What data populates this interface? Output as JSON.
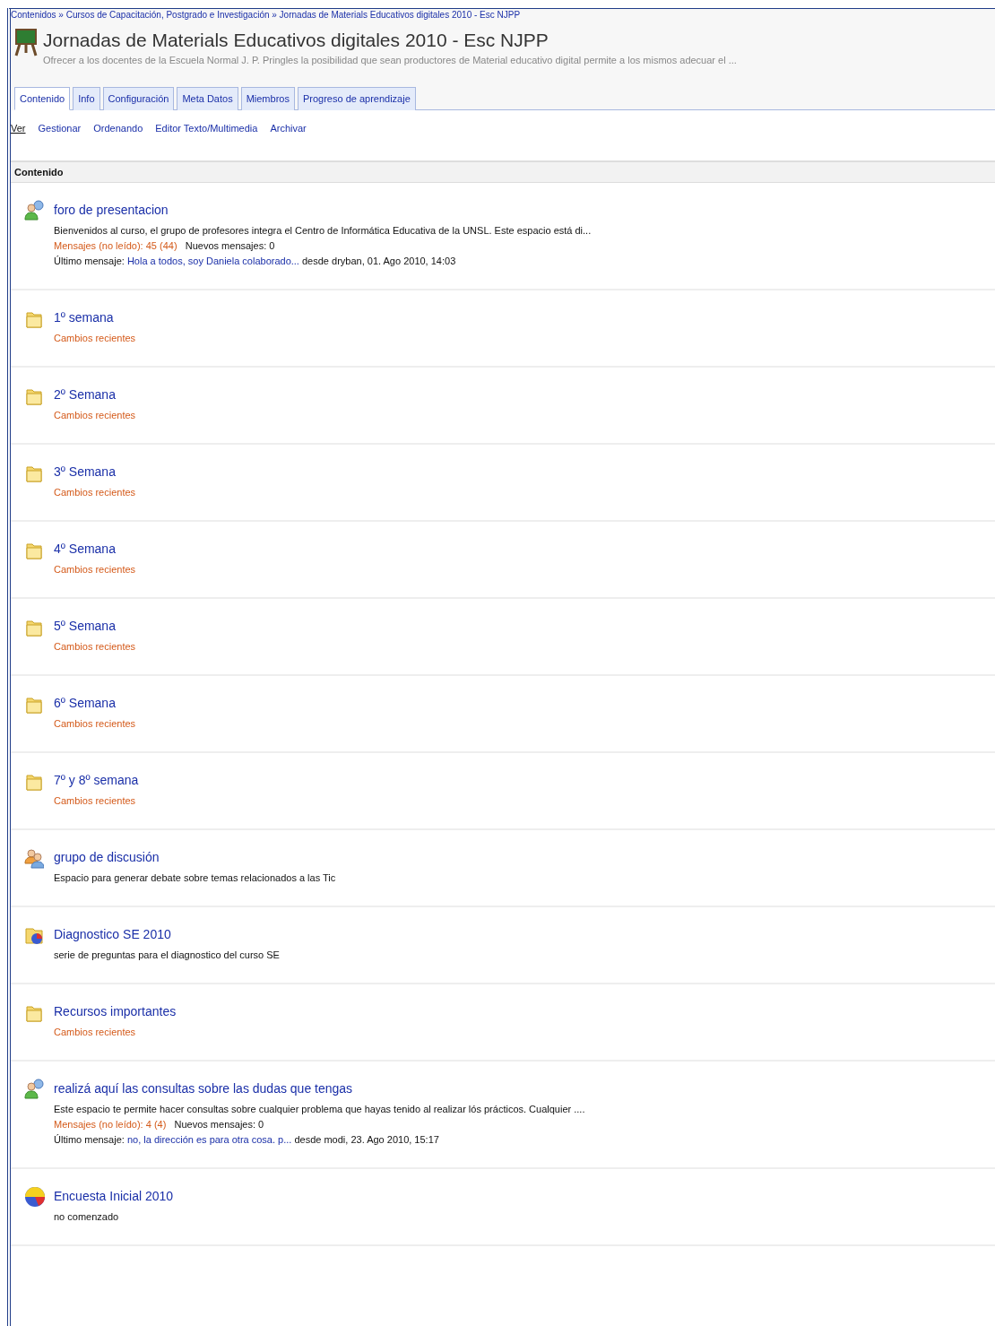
{
  "breadcrumb": "Contenidos » Cursos de Capacitación, Postgrado e Investigación » Jornadas de Materials Educativos digitales 2010 - Esc NJPP",
  "header": {
    "title": "Jornadas de Materials Educativos digitales 2010 - Esc NJPP",
    "description": "Ofrecer a los docentes de la Escuela Normal J. P. Pringles la posibilidad que sean productores de Material educativo digital permite a los mismos adecuar el ..."
  },
  "tabs": [
    {
      "label": "Contenido",
      "selected": true
    },
    {
      "label": "Info",
      "selected": false
    },
    {
      "label": "Configuración",
      "selected": false
    },
    {
      "label": "Meta Datos",
      "selected": false
    },
    {
      "label": "Miembros",
      "selected": false
    },
    {
      "label": "Progreso de aprendizaje",
      "selected": false
    }
  ],
  "subnav": [
    {
      "label": "Ver",
      "selected": true
    },
    {
      "label": "Gestionar",
      "selected": false
    },
    {
      "label": "Ordenando",
      "selected": false
    },
    {
      "label": "Editor Texto/Multimedia",
      "selected": false
    },
    {
      "label": "Archivar",
      "selected": false
    }
  ],
  "section_title": "Contenido",
  "items": [
    {
      "kind": "forum",
      "title": "foro de presentacion",
      "description": "Bienvenidos al curso, el grupo de profesores integra el Centro de Informática Educativa de la UNSL. Este espacio está di...",
      "unread": "Mensajes (no leído): 45 (44)",
      "new_messages": "Nuevos mensajes: 0",
      "last_label": "Último mensaje:",
      "last_link": "Hola  a todos, soy Daniela colaborado...",
      "last_meta": "desde dryban, 01. Ago 2010, 14:03"
    },
    {
      "kind": "folder",
      "title": "1º semana",
      "status": "Cambios recientes"
    },
    {
      "kind": "folder",
      "title": "2º Semana",
      "status": "Cambios recientes"
    },
    {
      "kind": "folder",
      "title": "3º Semana",
      "status": "Cambios recientes"
    },
    {
      "kind": "folder",
      "title": "4º Semana",
      "status": "Cambios recientes"
    },
    {
      "kind": "folder",
      "title": "5º Semana",
      "status": "Cambios recientes"
    },
    {
      "kind": "folder",
      "title": "6º Semana",
      "status": "Cambios recientes"
    },
    {
      "kind": "folder",
      "title": "7º y 8º semana",
      "status": "Cambios recientes"
    },
    {
      "kind": "group",
      "title": "grupo de discusión",
      "description": "Espacio para generar debate sobre temas relacionados a las Tic"
    },
    {
      "kind": "test",
      "title": "Diagnostico SE 2010",
      "description": "serie de preguntas para el diagnostico del curso SE"
    },
    {
      "kind": "folder",
      "title": "Recursos importantes",
      "status": "Cambios recientes"
    },
    {
      "kind": "forum",
      "title": "realizá aquí las consultas sobre las dudas que tengas",
      "description": "Este espacio te permite hacer consultas sobre cualquier problema que hayas tenido al realizar lós prácticos. Cualquier ....",
      "unread": "Mensajes (no leído): 4 (4)",
      "new_messages": "Nuevos mensajes: 0",
      "last_label": "Último mensaje:",
      "last_link": "no, la dirección es para otra cosa. p...",
      "last_meta": "desde modi, 23. Ago 2010, 15:17"
    },
    {
      "kind": "survey",
      "title": "Encuesta Inicial 2010",
      "description": "no comenzado"
    }
  ]
}
